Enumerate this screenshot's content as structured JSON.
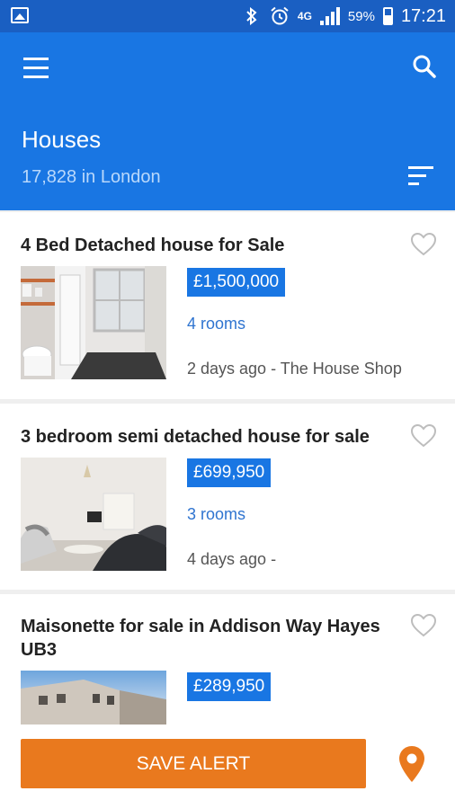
{
  "status": {
    "network": "4G",
    "battery": "59%",
    "time": "17:21"
  },
  "header": {
    "title": "Houses",
    "subtitle": "17,828 in London"
  },
  "listings": [
    {
      "title": "4 Bed Detached house for Sale",
      "price": "£1,500,000",
      "rooms": "4 rooms",
      "meta": "2 days ago  - The House Shop"
    },
    {
      "title": "3 bedroom semi detached house for sale",
      "price": "£699,950",
      "rooms": "3 rooms",
      "meta": "4 days ago  -"
    },
    {
      "title": "Maisonette for sale in Addison Way Hayes UB3",
      "price": "£289,950"
    }
  ],
  "actions": {
    "save_alert": "SAVE ALERT"
  },
  "colors": {
    "status_bar": "#1a5fc2",
    "app_bar": "#1976e3",
    "accent": "#e9791e",
    "price_badge": "#1976e3"
  }
}
